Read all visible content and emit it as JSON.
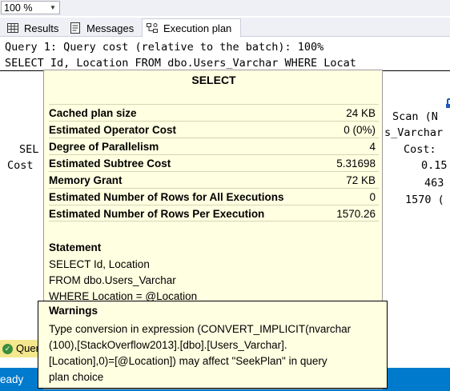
{
  "zoom": {
    "value": "100 %"
  },
  "tabs": [
    {
      "label": "Results",
      "icon": "grid-icon"
    },
    {
      "label": "Messages",
      "icon": "messages-icon"
    },
    {
      "label": "Execution plan",
      "icon": "execution-plan-icon"
    }
  ],
  "query": {
    "line1": "Query 1: Query cost (relative to the batch): 100%",
    "line2": "SELECT Id, Location FROM dbo.Users_Varchar WHERE Locat"
  },
  "plan_fragments": {
    "select_label": "SEL",
    "select_cost": "Cost",
    "scan_label": "Scan (N",
    "scan_table": "s_Varchar",
    "scan_cost": "Cost:",
    "scan_v1": "0.15",
    "scan_v2": "463",
    "scan_v3": "1570 ("
  },
  "tooltip": {
    "title": "SELECT",
    "properties": [
      {
        "name": "Cached plan size",
        "value": "24 KB"
      },
      {
        "name": "Estimated Operator Cost",
        "value": "0 (0%)"
      },
      {
        "name": "Degree of Parallelism",
        "value": "4"
      },
      {
        "name": "Estimated Subtree Cost",
        "value": "5.31698"
      },
      {
        "name": "Memory Grant",
        "value": "72 KB"
      },
      {
        "name": "Estimated Number of Rows for All Executions",
        "value": "0"
      },
      {
        "name": "Estimated Number of Rows Per Execution",
        "value": "1570.26"
      }
    ],
    "statement_heading": "Statement",
    "statement_lines": [
      "SELECT Id, Location",
      "FROM dbo.Users_Varchar",
      "WHERE Location = @Location"
    ],
    "warnings_heading": "Warnings",
    "warnings_lines": [
      "Type conversion in expression (CONVERT_IMPLICIT(nvarchar",
      "(100),[StackOverflow2013].[dbo].[Users_Varchar].",
      "[Location],0)=[@Location]) may affect \"SeekPlan\" in query",
      "plan choice"
    ]
  },
  "status": {
    "query_status": "Quer",
    "ready": "eady"
  },
  "colors": {
    "tooltip_bg": "#ffffe1",
    "status_bar": "#007acc",
    "query_ok_bg": "#f4e78e"
  }
}
